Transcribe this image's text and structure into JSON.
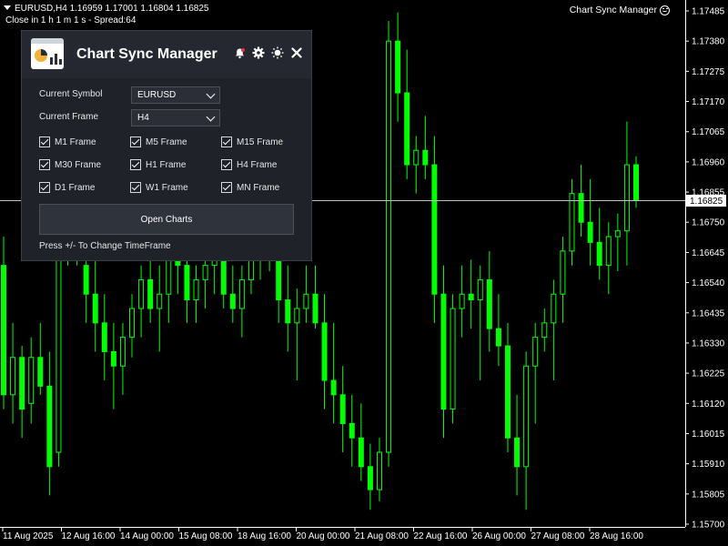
{
  "chart": {
    "header_line1": "EURUSD,H4  1.16959 1.17001 1.16804 1.16825",
    "header_line2": "Close in 1 h 1 m 1 s - Spread:64",
    "ea_label": "Chart Sync Manager",
    "current_price": "1.16825",
    "colors": {
      "background": "#000000",
      "candle": "#00ff00",
      "axis": "#ffffff",
      "price_line": "#c0c0c0"
    }
  },
  "panel": {
    "title": "Chart Sync Manager",
    "icons": [
      "bell-icon",
      "gear-icon",
      "sun-icon",
      "close-icon"
    ],
    "symbol_label": "Current Symbol",
    "symbol_value": "EURUSD",
    "frame_label": "Current Frame",
    "frame_value": "H4",
    "timeframes": [
      {
        "label": "M1 Frame",
        "checked": true
      },
      {
        "label": "M5 Frame",
        "checked": true
      },
      {
        "label": "M15 Frame",
        "checked": true
      },
      {
        "label": "M30 Frame",
        "checked": true
      },
      {
        "label": "H1 Frame",
        "checked": true
      },
      {
        "label": "H4 Frame",
        "checked": true
      },
      {
        "label": "D1 Frame",
        "checked": true
      },
      {
        "label": "W1 Frame",
        "checked": true
      },
      {
        "label": "MN Frame",
        "checked": true
      }
    ],
    "open_button": "Open Charts",
    "hint": "Press  +/-  To Change TimeFrame"
  },
  "chart_data": {
    "type": "candlestick",
    "price_ticks": [
      "1.17485",
      "1.17380",
      "1.17275",
      "1.17170",
      "1.17065",
      "1.16960",
      "1.16855",
      "1.16750",
      "1.16645",
      "1.16540",
      "1.16435",
      "1.16330",
      "1.16225",
      "1.16120",
      "1.16015",
      "1.15910",
      "1.15805",
      "1.15700"
    ],
    "time_ticks": [
      "11 Aug 2025",
      "12 Aug 16:00",
      "14 Aug 00:00",
      "15 Aug 08:00",
      "18 Aug 16:00",
      "20 Aug 00:00",
      "21 Aug 08:00",
      "22 Aug 16:00",
      "26 Aug 00:00",
      "27 Aug 08:00",
      "28 Aug 16:00"
    ],
    "ylim": [
      1.157,
      1.17485
    ],
    "candles": [
      [
        1.166,
        1.167,
        1.161,
        1.1615
      ],
      [
        1.1615,
        1.164,
        1.1605,
        1.1628
      ],
      [
        1.1628,
        1.1632,
        1.16,
        1.161
      ],
      [
        1.1612,
        1.1635,
        1.1605,
        1.1628
      ],
      [
        1.1628,
        1.164,
        1.1615,
        1.1618
      ],
      [
        1.1618,
        1.163,
        1.158,
        1.159
      ],
      [
        1.1595,
        1.169,
        1.159,
        1.168
      ],
      [
        1.1678,
        1.17,
        1.166,
        1.167
      ],
      [
        1.167,
        1.169,
        1.166,
        1.1665
      ],
      [
        1.166,
        1.1675,
        1.164,
        1.165
      ],
      [
        1.165,
        1.1662,
        1.163,
        1.164
      ],
      [
        1.164,
        1.165,
        1.162,
        1.163
      ],
      [
        1.163,
        1.164,
        1.161,
        1.1625
      ],
      [
        1.1625,
        1.164,
        1.1615,
        1.1635
      ],
      [
        1.1635,
        1.165,
        1.1628,
        1.1645
      ],
      [
        1.1645,
        1.166,
        1.1635,
        1.1655
      ],
      [
        1.1655,
        1.167,
        1.164,
        1.1645
      ],
      [
        1.1645,
        1.166,
        1.163,
        1.165
      ],
      [
        1.165,
        1.167,
        1.164,
        1.1665
      ],
      [
        1.1665,
        1.168,
        1.165,
        1.166
      ],
      [
        1.166,
        1.167,
        1.164,
        1.1648
      ],
      [
        1.1648,
        1.166,
        1.164,
        1.1655
      ],
      [
        1.1655,
        1.167,
        1.1645,
        1.166
      ],
      [
        1.166,
        1.167,
        1.165,
        1.1662
      ],
      [
        1.1662,
        1.167,
        1.1645,
        1.165
      ],
      [
        1.165,
        1.166,
        1.164,
        1.1645
      ],
      [
        1.1645,
        1.166,
        1.1635,
        1.1655
      ],
      [
        1.1655,
        1.167,
        1.165,
        1.1665
      ],
      [
        1.1665,
        1.168,
        1.1655,
        1.167
      ],
      [
        1.167,
        1.1685,
        1.1658,
        1.1662
      ],
      [
        1.1662,
        1.1672,
        1.164,
        1.1648
      ],
      [
        1.1648,
        1.166,
        1.163,
        1.164
      ],
      [
        1.164,
        1.1652,
        1.162,
        1.1645
      ],
      [
        1.1645,
        1.166,
        1.164,
        1.165
      ],
      [
        1.165,
        1.166,
        1.1638,
        1.164
      ],
      [
        1.164,
        1.165,
        1.161,
        1.162
      ],
      [
        1.162,
        1.164,
        1.1605,
        1.1615
      ],
      [
        1.1615,
        1.1625,
        1.1595,
        1.1605
      ],
      [
        1.1605,
        1.1615,
        1.159,
        1.16
      ],
      [
        1.16,
        1.1612,
        1.1585,
        1.159
      ],
      [
        1.159,
        1.1598,
        1.1575,
        1.1582
      ],
      [
        1.1582,
        1.16,
        1.1578,
        1.1595
      ],
      [
        1.1595,
        1.1745,
        1.159,
        1.1738
      ],
      [
        1.1738,
        1.1748,
        1.171,
        1.172
      ],
      [
        1.172,
        1.1735,
        1.169,
        1.1695
      ],
      [
        1.1695,
        1.1705,
        1.1685,
        1.17
      ],
      [
        1.17,
        1.1712,
        1.169,
        1.1695
      ],
      [
        1.1695,
        1.1705,
        1.164,
        1.165
      ],
      [
        1.165,
        1.166,
        1.16,
        1.161
      ],
      [
        1.161,
        1.165,
        1.1605,
        1.1645
      ],
      [
        1.1645,
        1.166,
        1.1635,
        1.165
      ],
      [
        1.165,
        1.1662,
        1.1638,
        1.1648
      ],
      [
        1.1648,
        1.166,
        1.162,
        1.1655
      ],
      [
        1.1655,
        1.1665,
        1.163,
        1.1638
      ],
      [
        1.1638,
        1.165,
        1.1625,
        1.1632
      ],
      [
        1.1632,
        1.164,
        1.1595,
        1.16
      ],
      [
        1.16,
        1.1615,
        1.158,
        1.159
      ],
      [
        1.159,
        1.163,
        1.1575,
        1.1625
      ],
      [
        1.1625,
        1.164,
        1.1605,
        1.1635
      ],
      [
        1.1635,
        1.1645,
        1.163,
        1.164
      ],
      [
        1.164,
        1.1655,
        1.162,
        1.165
      ],
      [
        1.165,
        1.167,
        1.164,
        1.1665
      ],
      [
        1.1665,
        1.169,
        1.166,
        1.1685
      ],
      [
        1.1685,
        1.1695,
        1.167,
        1.1675
      ],
      [
        1.1675,
        1.169,
        1.166,
        1.1668
      ],
      [
        1.1668,
        1.168,
        1.1655,
        1.166
      ],
      [
        1.166,
        1.1675,
        1.165,
        1.167
      ],
      [
        1.167,
        1.1678,
        1.1658,
        1.1672
      ],
      [
        1.1672,
        1.171,
        1.166,
        1.1695
      ],
      [
        1.1695,
        1.1698,
        1.168,
        1.16825
      ]
    ]
  }
}
